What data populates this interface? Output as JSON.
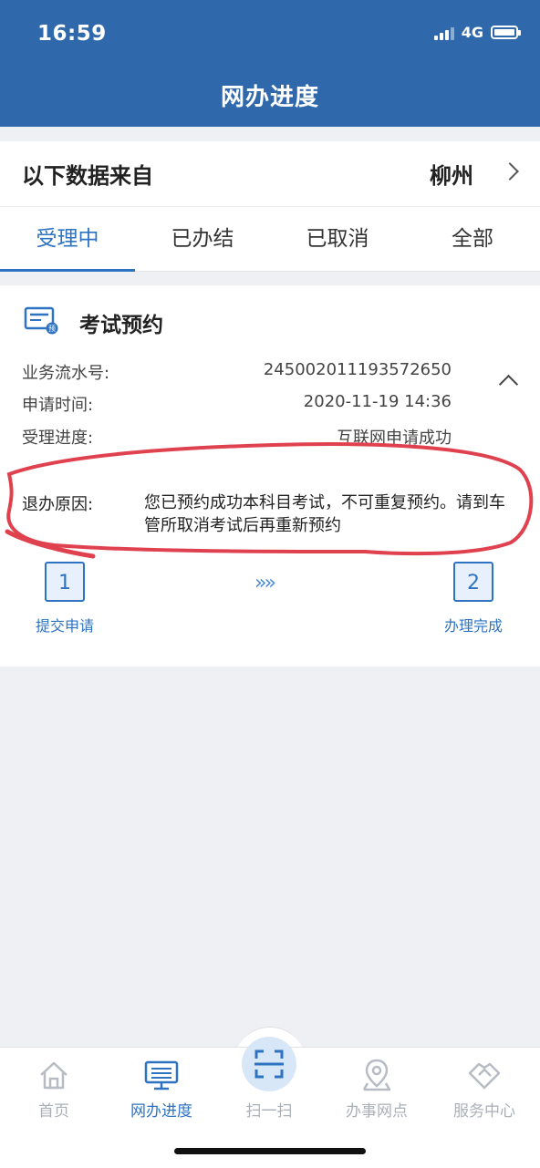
{
  "status_bar": {
    "time": "16:59",
    "network": "4G"
  },
  "header": {
    "title": "网办进度"
  },
  "source": {
    "label": "以下数据来自",
    "city": "柳州"
  },
  "tabs": [
    {
      "label": "受理中",
      "active": true
    },
    {
      "label": "已办结",
      "active": false
    },
    {
      "label": "已取消",
      "active": false
    },
    {
      "label": "全部",
      "active": false
    }
  ],
  "card": {
    "title": "考试预约",
    "icon_badge": "预",
    "rows": [
      {
        "label": "业务流水号:",
        "value": "245002011193572650"
      },
      {
        "label": "申请时间:",
        "value": "2020-11-19 14:36"
      },
      {
        "label": "受理进度:",
        "value": "互联网申请成功"
      }
    ],
    "reason": {
      "label": "退办原因:",
      "text": "您已预约成功本科目考试，不可重复预约。请到车管所取消考试后再重新预约"
    },
    "steps": [
      {
        "number": "1",
        "label": "提交申请"
      },
      {
        "number": "2",
        "label": "办理完成"
      }
    ],
    "arrows": "»»"
  },
  "tabbar": [
    {
      "label": "首页",
      "icon": "home-icon",
      "active": false
    },
    {
      "label": "网办进度",
      "icon": "monitor-icon",
      "active": true
    },
    {
      "label": "扫一扫",
      "icon": "scan-icon",
      "active": false
    },
    {
      "label": "办事网点",
      "icon": "location-pin-icon",
      "active": false
    },
    {
      "label": "服务中心",
      "icon": "handshake-icon",
      "active": false
    }
  ],
  "colors": {
    "header": "#2f68ab",
    "accent": "#2e73c2",
    "annotation": "#e0414e"
  }
}
